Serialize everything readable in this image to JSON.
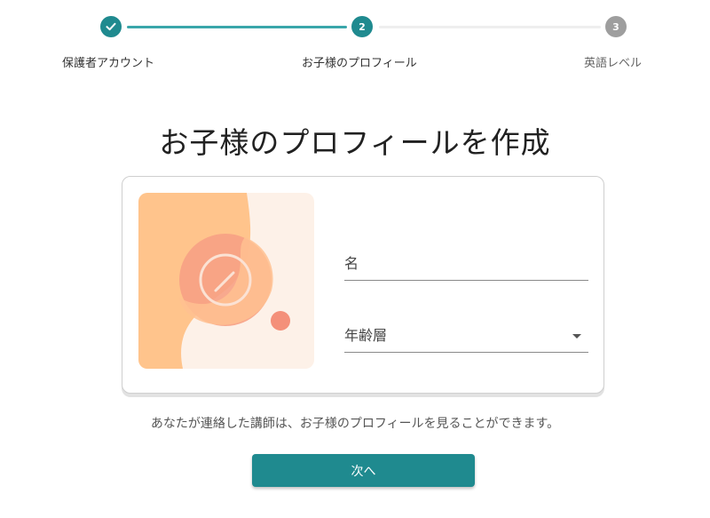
{
  "stepper": {
    "steps": [
      {
        "number": "",
        "label": "保護者アカウント",
        "status": "completed"
      },
      {
        "number": "2",
        "label": "お子様のプロフィール",
        "status": "active"
      },
      {
        "number": "3",
        "label": "英語レベル",
        "status": "upcoming"
      }
    ]
  },
  "page": {
    "title": "お子様のプロフィールを作成",
    "note": "あなたが連絡した講師は、お子様のプロフィールを見ることができます。"
  },
  "form": {
    "name_placeholder": "名",
    "age_placeholder": "年齢層"
  },
  "actions": {
    "next_label": "次へ"
  },
  "colors": {
    "primary": "#1f8a8f",
    "step_line_active": "#3aa6aa",
    "step_inactive": "#9e9e9e",
    "avatar_orange": "#ffc48c",
    "avatar_cream": "#fdf1e8",
    "avatar_salmon": "#f4907a"
  },
  "icons": {
    "step1": "check-icon",
    "avatar": "pencil-icon",
    "select": "caret-down-icon"
  }
}
